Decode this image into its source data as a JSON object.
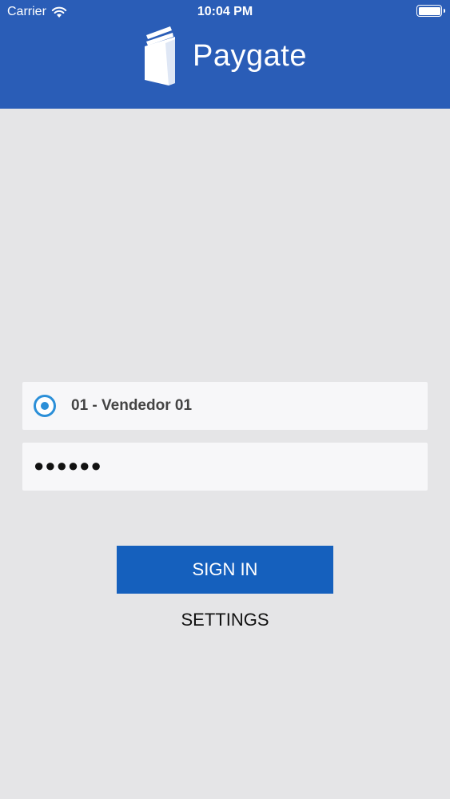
{
  "status_bar": {
    "carrier": "Carrier",
    "time": "10:04 PM",
    "wifi_icon": "wifi-icon",
    "battery_icon": "battery-icon"
  },
  "header": {
    "logo_icon": "wallet-logo-icon",
    "title": "Paygate",
    "background_color": "#2a5db7"
  },
  "login_form": {
    "seller_icon": "radio-selected-icon",
    "seller_value": "01 - Vendedor 01",
    "password_value": "●●●●●●",
    "sign_in_label": "SIGN IN",
    "settings_label": "SETTINGS",
    "accent_color": "#1560bd"
  }
}
